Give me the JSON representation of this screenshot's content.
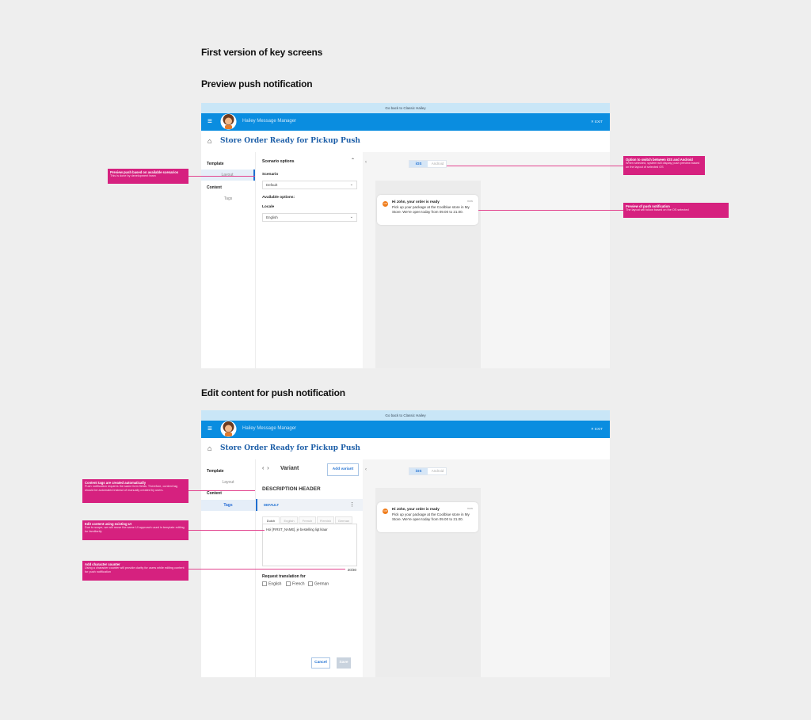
{
  "headings": {
    "main": "First version of key screens",
    "preview_section": "Preview push notification",
    "edit_section": "Edit content for push notification"
  },
  "app": {
    "banner": "Go back to Classic Hailey",
    "title": "Hailey Message Manager",
    "exit": "✕ EXIT",
    "page_title": "Store Order Ready for Pickup Push"
  },
  "nav": {
    "template": "Template",
    "layout": "Layout",
    "content": "Content",
    "tags": "Tags"
  },
  "scenario": {
    "header": "Scenario options",
    "scenario_label": "Scenario",
    "scenario_value": "Default",
    "available": "Available options:",
    "locale_label": "Locale",
    "locale_value": "English"
  },
  "toggle": {
    "ios": "iOS",
    "android": "Android"
  },
  "notification": {
    "icon": "app-logo-icon",
    "title": "Hi John, your order is ready",
    "time": "now",
    "text": "Pick up your package at the Coolblue store in My Store. We're open today from 09.00 to 21.00."
  },
  "editor": {
    "variant_title": "Variant",
    "add_variant": "Add variant",
    "description_header": "DESCRIPTION HEADER",
    "default_label": "DEFAULT",
    "lang_tabs": [
      "Dutch",
      "English",
      "French",
      "Flemish",
      "German"
    ],
    "content": "Hoi [FIRST_NAME], je bestelling ligt klaar",
    "counter": "20/30",
    "request_translation": "Request translation for",
    "translation_options": [
      "English",
      "French",
      "German"
    ],
    "cancel": "Cancel",
    "save": "Save"
  },
  "annotations": {
    "preview_push": {
      "title": "Preview push based on available scenarios",
      "body": "This is done by development team"
    },
    "switch_os": {
      "title": "Option to switch between iOS and Android",
      "body": "When selected, system will display push preview based on the layout of selected OS"
    },
    "preview_notification": {
      "title": "Preview of push notification",
      "body": "The layout will follow based on the OS selected"
    },
    "content_tags": {
      "title": "Content tags are created automatically",
      "body": "Push notification requires the same form fields. Therefore, content tag should be automated instead of manually created by users."
    },
    "edit_content": {
      "title": "Edit content using existing UI",
      "body": "Due to scope, we will reuse the same UI approach used in template editing for familiarity"
    },
    "char_counter": {
      "title": "Add character counter",
      "body": "Using a character counter will provide clarity for users while editing content for push notification"
    }
  },
  "colors": {
    "topbar": "#0a8de0",
    "annotation": "#d6217f",
    "accent": "#1e6fd1",
    "title": "#1e5fa8"
  }
}
